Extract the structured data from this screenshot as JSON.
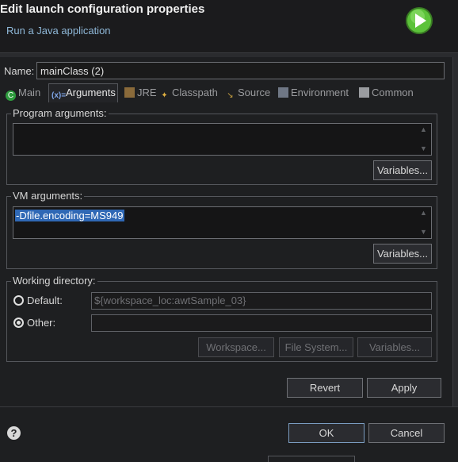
{
  "dialog": {
    "title": "Edit launch configuration properties",
    "subtitle": "Run a Java application",
    "run_icon": "run-play-icon"
  },
  "name": {
    "label": "Name:",
    "value": "mainClass (2)"
  },
  "tabs": [
    {
      "label": "Main",
      "icon": "main-class-icon",
      "active": false
    },
    {
      "label": "Arguments",
      "icon": "arguments-icon",
      "active": true
    },
    {
      "label": "JRE",
      "icon": "jre-library-icon",
      "active": false
    },
    {
      "label": "Classpath",
      "icon": "classpath-icon",
      "active": false
    },
    {
      "label": "Source",
      "icon": "source-icon",
      "active": false
    },
    {
      "label": "Environment",
      "icon": "environment-icon",
      "active": false
    },
    {
      "label": "Common",
      "icon": "common-icon",
      "active": false
    }
  ],
  "program_arguments": {
    "label": "Program arguments:",
    "value": "",
    "variables_button": "Variables..."
  },
  "vm_arguments": {
    "label": "VM arguments:",
    "value": "-Dfile.encoding=MS949",
    "variables_button": "Variables..."
  },
  "working_directory": {
    "label": "Working directory:",
    "default_label": "Default:",
    "default_value": "${workspace_loc:awtSample_03}",
    "other_label": "Other:",
    "other_value": "",
    "selected": "default",
    "workspace_button": "Workspace...",
    "file_system_button": "File System...",
    "variables_button": "Variables..."
  },
  "actions": {
    "revert": "Revert",
    "apply": "Apply"
  },
  "footer": {
    "ok": "OK",
    "cancel": "Cancel",
    "help_icon": "help-icon"
  },
  "colors": {
    "background": "#1e1f21",
    "accent_selection": "#2f68b5",
    "run_icon_green": "#3cb043"
  }
}
